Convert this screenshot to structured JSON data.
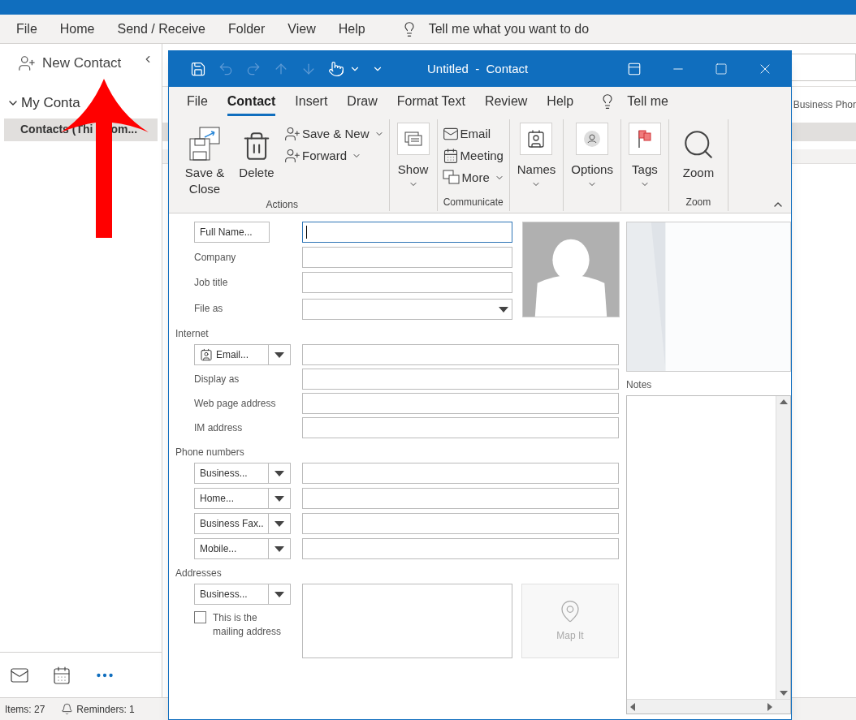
{
  "menu": [
    "File",
    "Home",
    "Send / Receive",
    "Folder",
    "View",
    "Help"
  ],
  "tell_me": "Tell me what you want to do",
  "sidebar": {
    "new_contact": "New Contact",
    "folder_group": {
      "label": "My Conta",
      "expanded": true
    },
    "folders": [
      {
        "label": "Contacts (Thi",
        "label_after_arrow": "om...",
        "selected": true
      }
    ]
  },
  "list": {
    "column_1": "Business Phor"
  },
  "status_bar": {
    "items": "Items: 27",
    "reminders": "Reminders: 1"
  },
  "contact_window": {
    "title": "Untitled  -  Contact",
    "quick_access": [
      {
        "disabled": false
      },
      {
        "disabled": true
      },
      {
        "disabled": true
      },
      {
        "disabled": true
      },
      {
        "disabled": true
      },
      {
        "disabled": false
      }
    ],
    "tabs": [
      {
        "label": "File",
        "selected": false
      },
      {
        "label": "Contact",
        "selected": true
      },
      {
        "label": "Insert",
        "selected": false
      },
      {
        "label": "Draw",
        "selected": false
      },
      {
        "label": "Format Text",
        "selected": false
      },
      {
        "label": "Review",
        "selected": false
      },
      {
        "label": "Help",
        "selected": false
      }
    ],
    "tell_me": "Tell me",
    "ribbon": [
      {
        "label": "Actions",
        "buttons": [
          {
            "kind": "large",
            "label": "Save & Close",
            "menu": false
          },
          {
            "kind": "large",
            "label": "Delete",
            "menu": false
          },
          {
            "kind": "small",
            "label": "Save & New",
            "menu": true
          },
          {
            "kind": "small",
            "label": "Forward",
            "menu": true
          }
        ]
      },
      {
        "buttons": [
          {
            "kind": "boxed",
            "label": "Show",
            "menu": true
          }
        ]
      },
      {
        "label": "Communicate",
        "buttons": [
          {
            "kind": "small",
            "label": "Email",
            "menu": false
          },
          {
            "kind": "small",
            "label": "Meeting",
            "menu": false
          },
          {
            "kind": "small",
            "label": "More",
            "menu": true
          }
        ]
      },
      {
        "buttons": [
          {
            "kind": "boxed",
            "label": "Names",
            "menu": true
          }
        ]
      },
      {
        "buttons": [
          {
            "kind": "boxed",
            "label": "Options",
            "menu": true
          }
        ]
      },
      {
        "buttons": [
          {
            "kind": "boxed",
            "label": "Tags",
            "menu": true
          }
        ]
      },
      {
        "label": "Zoom",
        "buttons": [
          {
            "kind": "large",
            "label": "Zoom",
            "menu": false
          }
        ]
      }
    ],
    "form": {
      "top_rows": [
        {
          "kind": "button",
          "label": "Full Name...",
          "dropdown": false,
          "focused": true
        },
        {
          "kind": "label",
          "label": "Company",
          "dropdown": false,
          "focused": false
        },
        {
          "kind": "label",
          "label": "Job title",
          "dropdown": false,
          "focused": false
        },
        {
          "kind": "label",
          "label": "File as",
          "dropdown": true,
          "focused": false
        }
      ],
      "sections": [
        {
          "title": "Internet",
          "rows": [
            {
              "kind": "split_icon",
              "label": "Email..."
            },
            {
              "kind": "label",
              "label": "Display as"
            },
            {
              "kind": "label",
              "label": "Web page address"
            },
            {
              "kind": "label",
              "label": "IM address"
            }
          ]
        },
        {
          "title": "Phone numbers",
          "rows": [
            {
              "kind": "split",
              "label": "Business..."
            },
            {
              "kind": "split",
              "label": "Home..."
            },
            {
              "kind": "split",
              "label": "Business Fax.."
            },
            {
              "kind": "split",
              "label": "Mobile..."
            }
          ]
        }
      ],
      "addresses": {
        "title": "Addresses",
        "type_button": "Business...",
        "mailing_checkbox": {
          "label": "This is the mailing address",
          "checked": false
        },
        "map_button": {
          "label": "Map It",
          "disabled": true
        }
      },
      "notes_label": "Notes"
    }
  }
}
